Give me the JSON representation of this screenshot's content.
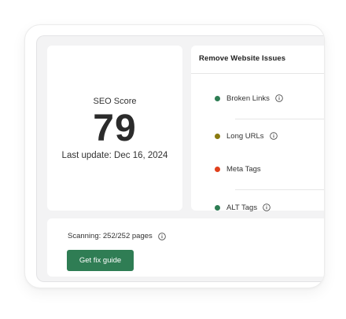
{
  "seo": {
    "label": "SEO Score",
    "value": "79",
    "last_update": "Last update: Dec 16, 2024"
  },
  "issues": {
    "title": "Remove Website Issues",
    "items": [
      {
        "label": "Broken Links",
        "color": "#2e7d54",
        "has_info": true
      },
      {
        "label": "Long URLs",
        "color": "#8a7a10",
        "has_info": true
      },
      {
        "label": "Meta Tags",
        "color": "#e0401c",
        "has_info": false
      },
      {
        "label": "ALT Tags",
        "color": "#2e7d54",
        "has_info": true
      }
    ]
  },
  "scan": {
    "status": "Scanning: 252/252 pages",
    "button_label": "Get fix guide"
  },
  "colors": {
    "accent": "#2f7d54",
    "background": "#f3f3f4"
  }
}
